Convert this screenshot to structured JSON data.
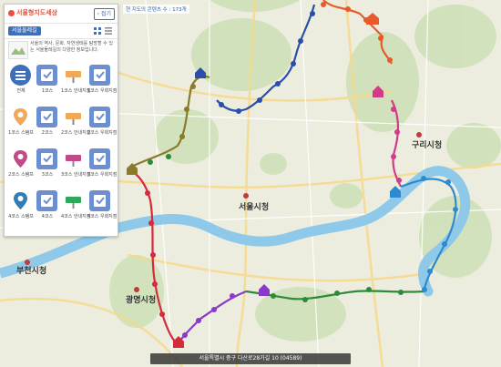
{
  "panel": {
    "logo_text": "서울형지도세상",
    "fold_button": "접기",
    "tab_label": "서울둘레길",
    "intro_text": "서울의 역사, 문화, 자연생태를 탐방할 수 있는 서울둘레길의 다양한 정보입니다.",
    "items": [
      {
        "label": "전체",
        "color": "#3f6fb8",
        "icon": "list-icon"
      },
      {
        "label": "1코스",
        "color": "#6b8fd0",
        "icon": "checkbox-icon"
      },
      {
        "label": "1코스 안내지점",
        "color": "#f0a85a",
        "icon": "sign-icon"
      },
      {
        "label": "1코스 우회지점",
        "color": "#6b8fd0",
        "icon": "checkbox-icon"
      },
      {
        "label": "1코스 스탬프",
        "color": "#f0a85a",
        "icon": "pin-icon"
      },
      {
        "label": "2코스",
        "color": "#6b8fd0",
        "icon": "checkbox-icon"
      },
      {
        "label": "2코스 안내지점",
        "color": "#f0a85a",
        "icon": "sign-icon"
      },
      {
        "label": "2코스 우회지점",
        "color": "#6b8fd0",
        "icon": "checkbox-icon"
      },
      {
        "label": "2코스 스탬프",
        "color": "#c24a8a",
        "icon": "pin-icon"
      },
      {
        "label": "3코스",
        "color": "#6b8fd0",
        "icon": "checkbox-icon"
      },
      {
        "label": "3코스 안내지점",
        "color": "#c24a8a",
        "icon": "sign-icon"
      },
      {
        "label": "3코스 우회지점",
        "color": "#6b8fd0",
        "icon": "checkbox-icon"
      },
      {
        "label": "4코스 스탬프",
        "color": "#2e7fb8",
        "icon": "pin-icon"
      },
      {
        "label": "4코스",
        "color": "#6b8fd0",
        "icon": "checkbox-icon"
      },
      {
        "label": "4코스 안내지점",
        "color": "#2ea85a",
        "icon": "sign-icon"
      },
      {
        "label": "4코스 우회지점",
        "color": "#6b8fd0",
        "icon": "checkbox-icon"
      }
    ]
  },
  "info_badge": "현 지도의 콘텐츠 수 : 173개",
  "map_labels": {
    "seoul_city_hall": "서울시청",
    "guri_city_hall": "구리시청",
    "bucheon_city_hall": "부천시청",
    "gwangmyeong_city_hall": "광명시청"
  },
  "bottom_bar": "서울특별시 중구 다산로28가길 10 (04589)",
  "route_colors": {
    "orange": "#e85a2a",
    "navy": "#2a4fa8",
    "magenta": "#d33a8a",
    "blue": "#2e8ad0",
    "green": "#2e8a3a",
    "purple": "#8a3ac8",
    "red": "#d42a3a",
    "olive": "#8a7a2a"
  }
}
